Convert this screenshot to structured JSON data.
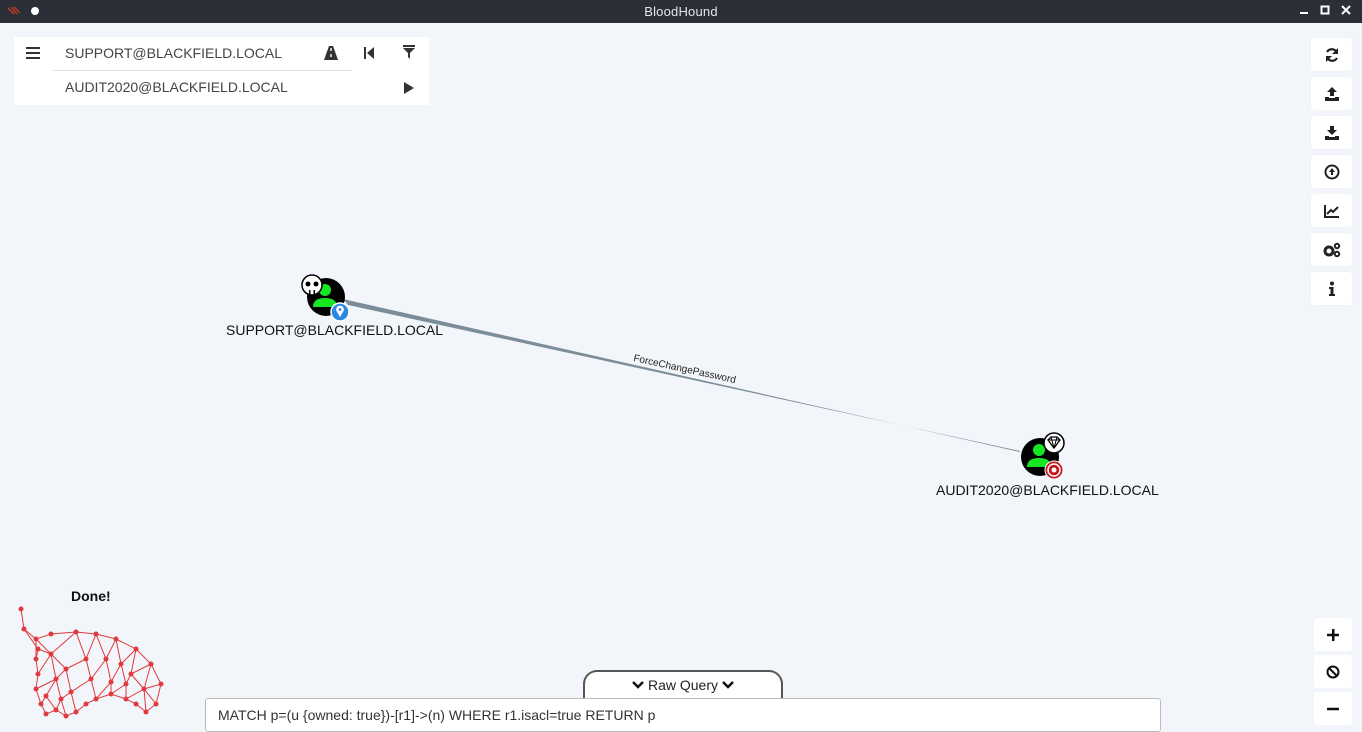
{
  "window": {
    "title": "BloodHound"
  },
  "search": {
    "start_node": "SUPPORT@BLACKFIELD.LOCAL",
    "target_node": "AUDIT2020@BLACKFIELD.LOCAL"
  },
  "graph": {
    "nodes": [
      {
        "label": "SUPPORT@BLACKFIELD.LOCAL",
        "type": "User",
        "owned": true,
        "start": true
      },
      {
        "label": "AUDIT2020@BLACKFIELD.LOCAL",
        "type": "User",
        "high_value": true,
        "target": true
      }
    ],
    "edge": {
      "label": "ForceChangePassword"
    }
  },
  "status": {
    "text": "Done!"
  },
  "raw_query": {
    "tab_label": "Raw Query",
    "value": "MATCH p=(u {owned: true})-[r1]->(n) WHERE r1.isacl=true RETURN p"
  },
  "colors": {
    "titlebar": "#2b2f37",
    "background": "#f2f5f9",
    "user_node": "#17e625",
    "edge": "#7c8d9a",
    "loader": "#e0393e"
  },
  "icons": {
    "toolbar_right": [
      "refresh-icon",
      "upload-icon",
      "download-icon",
      "upload-circle-icon",
      "chart-icon",
      "cogs-icon",
      "info-icon"
    ],
    "zoom": [
      "plus-icon",
      "ban-icon",
      "minus-icon"
    ]
  }
}
